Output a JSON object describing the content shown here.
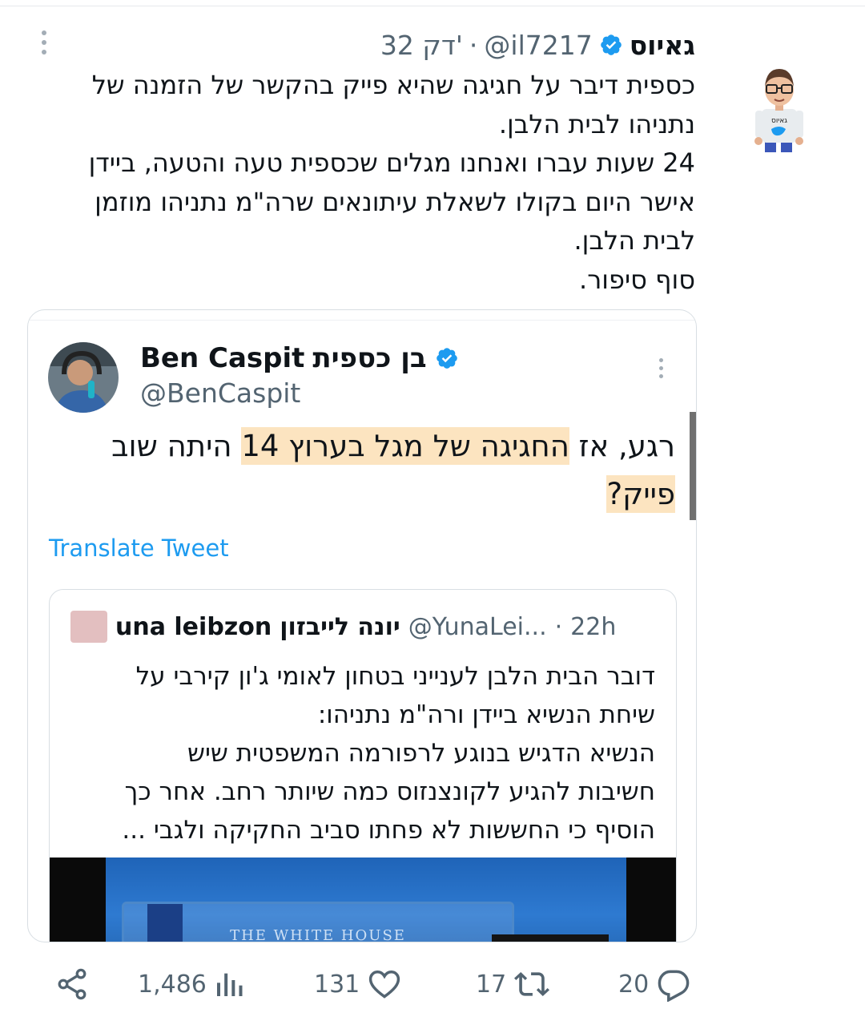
{
  "tweet": {
    "author_name": "גאיוס",
    "handle": "@il7217",
    "separator": "·",
    "time": "32 דק'",
    "body_lines": [
      "כספית דיבר על חגיגה שהיא פייק בהקשר של הזמנה של",
      "נתניהו לבית הלבן.",
      "24 שעות עברו ואנחנו מגלים שכספית טעה והטעה, ביידן",
      "אישר היום בקולו לשאלת עיתונאים שרה\"מ נתניהו מוזמן",
      "לבית הלבן.",
      "סוף סיפור."
    ]
  },
  "quoted": {
    "name_he": "בן כספית",
    "name_en": "Ben Caspit",
    "handle": "@BenCaspit",
    "text_part1": "רגע, אז ",
    "text_highlight": "החגיגה של מגל בערוץ 14",
    "text_part2": " היתה שוב ",
    "text_highlight2": "פייק?",
    "translate_label": "Translate Tweet"
  },
  "nested": {
    "name_en": "una leibzon",
    "name_he": "יונה לייבזון",
    "handle": "@YunaLei...",
    "separator": "·",
    "time": "22h",
    "lines": [
      "דובר הבית הלבן לענייני בטחון לאומי ג'ון קירבי על",
      "שיחת הנשיא ביידן ורה\"מ נתניהו:",
      "הנשיא הדגיש בנוגע לרפורמה המשפטית שיש",
      "חשיבות להגיע לקונצנזוס כמה שיותר רחב. אחר כך",
      "הוסיף כי החששות לא פחתו סביב החקיקה ולגבי ..."
    ],
    "media_text": "THE WHITE HOUSE"
  },
  "actions": {
    "views": "1,486",
    "likes": "131",
    "retweets": "17",
    "replies": "20"
  },
  "colors": {
    "accent": "#1d9bf0",
    "muted": "#536471",
    "highlight": "#facd8c"
  }
}
